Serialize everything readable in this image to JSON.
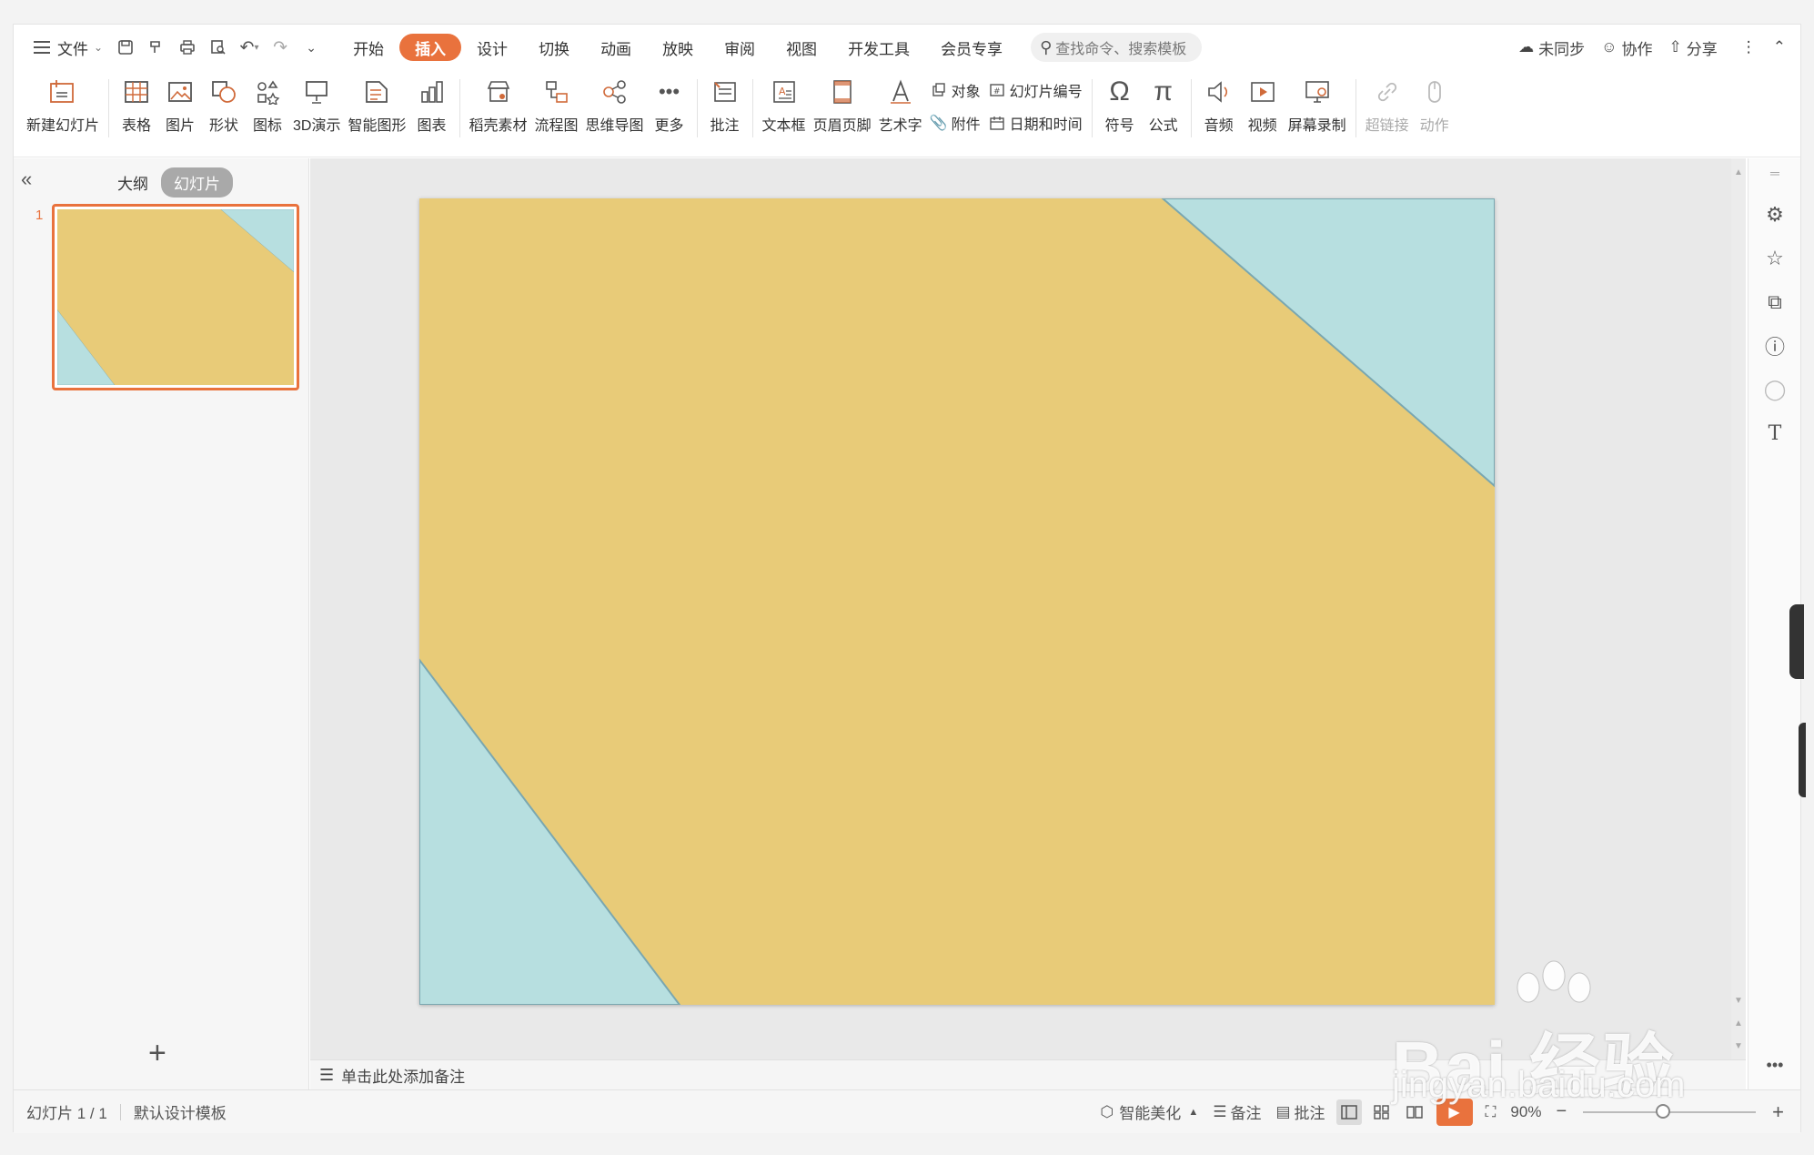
{
  "menubar": {
    "file_label": "文件",
    "tabs": [
      "开始",
      "插入",
      "设计",
      "切换",
      "动画",
      "放映",
      "审阅",
      "视图",
      "开发工具",
      "会员专享"
    ],
    "active_tab": "插入",
    "search_placeholder": "查找命令、搜索模板",
    "actions": {
      "sync": "未同步",
      "collab": "协作",
      "share": "分享"
    }
  },
  "ribbon": {
    "new_slide": "新建幻灯片",
    "table": "表格",
    "picture": "图片",
    "shape": "形状",
    "icon": "图标",
    "demo3d": "3D演示",
    "smartart": "智能图形",
    "chart": "图表",
    "daoke": "稻壳素材",
    "flowchart": "流程图",
    "mindmap": "思维导图",
    "more": "更多",
    "comment": "批注",
    "textbox": "文本框",
    "header_footer": "页眉页脚",
    "wordart": "艺术字",
    "object": "对象",
    "attachment": "附件",
    "slide_number": "幻灯片编号",
    "datetime": "日期和时间",
    "symbol": "符号",
    "formula": "公式",
    "audio": "音频",
    "video": "视频",
    "screen_record": "屏幕录制",
    "hyperlink": "超链接",
    "action": "动作"
  },
  "leftpanel": {
    "tab_outline": "大纲",
    "tab_slides": "幻灯片",
    "slide_number": "1"
  },
  "slide": {
    "background_color": "#e8cb78",
    "accent_color": "#b7dfe0",
    "outline_color": "#7aa7b0"
  },
  "notes_placeholder": "单击此处添加备注",
  "statusbar": {
    "slide_counter": "幻灯片 1 / 1",
    "template": "默认设计模板",
    "beautify": "智能美化",
    "notes": "备注",
    "comments": "批注",
    "zoom": "90%"
  },
  "watermark": {
    "brand": "Bai 经验",
    "url": "jingyan.baidu.com"
  }
}
